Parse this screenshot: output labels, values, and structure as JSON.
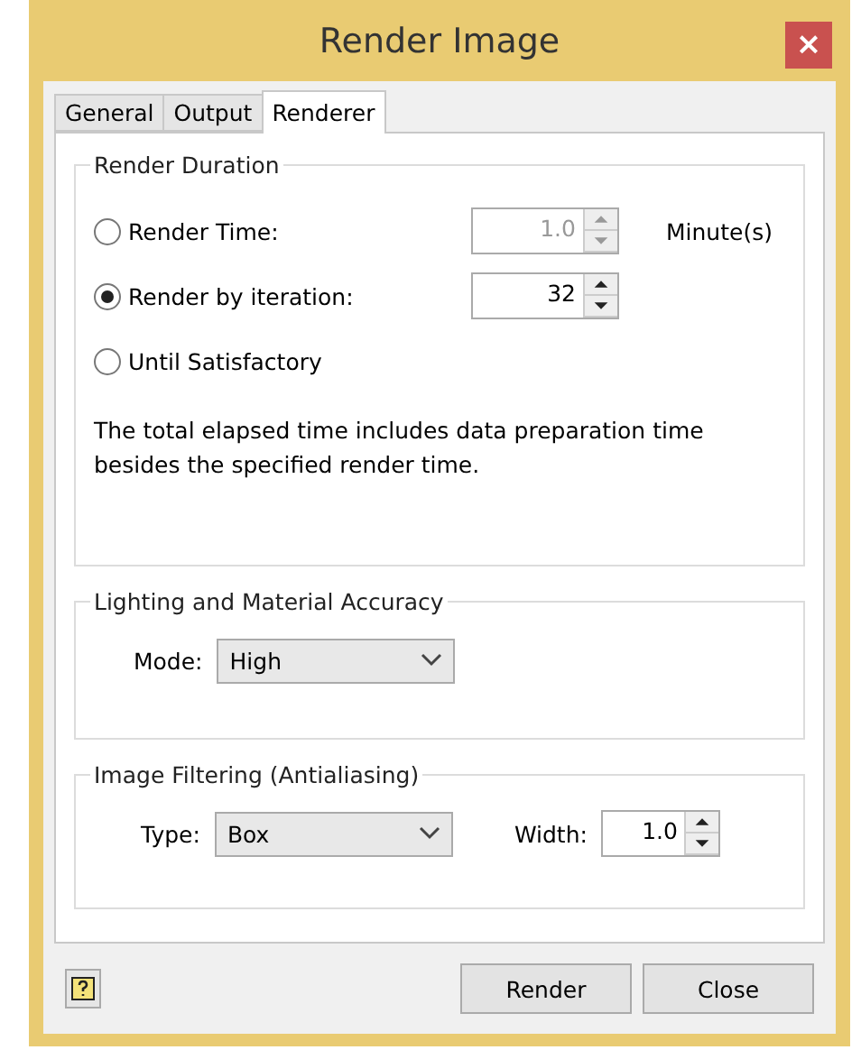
{
  "window": {
    "title": "Render Image",
    "close": "×"
  },
  "tabs": [
    {
      "label": "General",
      "selected": false
    },
    {
      "label": "Output",
      "selected": false
    },
    {
      "label": "Renderer",
      "selected": true
    }
  ],
  "render_duration": {
    "title": "Render Duration",
    "options": [
      {
        "label": "Render Time:",
        "selected": false,
        "spinner": {
          "value": "1.0",
          "disabled": true
        },
        "unit": "Minute(s)"
      },
      {
        "label": "Render by iteration:",
        "selected": true,
        "spinner": {
          "value": "32",
          "disabled": false
        }
      },
      {
        "label": "Until Satisfactory",
        "selected": false
      }
    ],
    "note": "The total elapsed time includes data preparation time besides the specified render time."
  },
  "lighting": {
    "title": "Lighting and Material Accuracy",
    "mode_label": "Mode:",
    "mode": "High"
  },
  "filtering": {
    "title": "Image Filtering (Antialiasing)",
    "type_label": "Type:",
    "type": "Box",
    "width_label": "Width:",
    "width": {
      "value": "1.0",
      "disabled": false
    }
  },
  "buttons": [
    "Render",
    "Close"
  ]
}
